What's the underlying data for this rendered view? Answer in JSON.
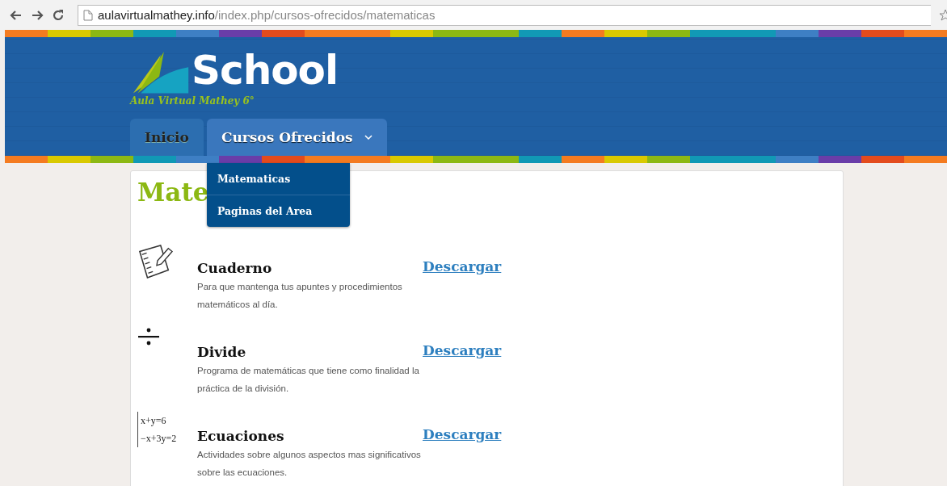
{
  "browser": {
    "url_host": "aulavirtualmathey.info",
    "url_path": "/index.php/cursos-ofrecidos/matematicas"
  },
  "logo": {
    "title": "School",
    "subtitle": "Aula Virtual Mathey 6°"
  },
  "nav": [
    {
      "label": "Inicio",
      "selected": false,
      "has_menu": false
    },
    {
      "label": "Cursos Ofrecidos",
      "selected": true,
      "has_menu": true
    }
  ],
  "dropdown": [
    "Matematicas",
    "Paginas del Area"
  ],
  "page_title": "Mate",
  "items": [
    {
      "kind": "notebook",
      "title": "Cuaderno",
      "description": "Para que mantenga tus apuntes y procedimientos matemáticos al día.",
      "link": "Descargar"
    },
    {
      "kind": "divide",
      "title": "Divide",
      "description": "Programa de matemáticas que tiene como finalidad la práctica de la división.",
      "link": "Descargar"
    },
    {
      "kind": "equations",
      "icon_lines": [
        "x+y=6",
        "−x+3y=2"
      ],
      "title": "Ecuaciones",
      "description": "Actividades sobre algunos aspectos mas significativos sobre las ecuaciones.",
      "link": "Descargar"
    }
  ]
}
